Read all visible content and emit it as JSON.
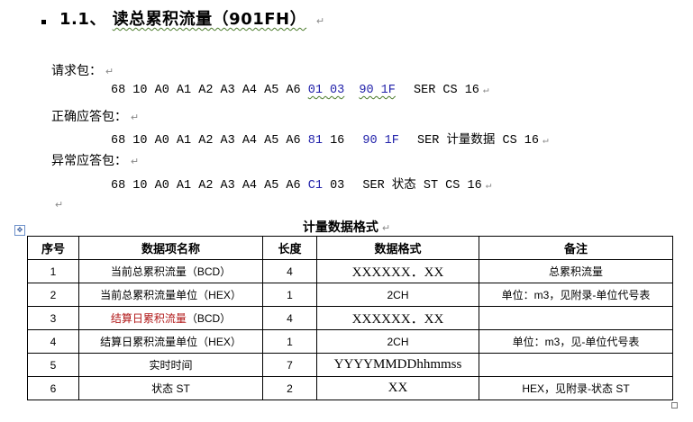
{
  "heading": {
    "number": "1.1、",
    "title": "读总累积流量（901FH）",
    "para_mark": "↵"
  },
  "request": {
    "label": "请求包：",
    "bytes": "68 10 A0 A1 A2 A3 A4 A5 A6",
    "blue_a": "01 03",
    "blue_b": "90 1F",
    "tail": "SER   CS   16"
  },
  "ack": {
    "label": "正确应答包：",
    "bytes": "68 10 A0 A1 A2 A3 A4 A5 A6",
    "blue_a": "81",
    "mid": "16",
    "blue_b": "90 1F",
    "tail": "SER 计量数据 CS   16"
  },
  "nak": {
    "label": "异常应答包：",
    "bytes": "68 10 A0 A1 A2 A3 A4 A5 A6",
    "blue_a": "C1",
    "mid": "03",
    "tail": "SER   状态 ST   CS   16"
  },
  "table_title": "计量数据格式",
  "table": {
    "headers": [
      "序号",
      "数据项名称",
      "长度",
      "数据格式",
      "备注"
    ],
    "rows": [
      {
        "no": "1",
        "name": "当前总累积流量（BCD）",
        "len": "4",
        "fmt": "XXXXXX．XX",
        "note": "总累积流量"
      },
      {
        "no": "2",
        "name": "当前总累积流量单位（HEX）",
        "len": "1",
        "fmt": "2CH",
        "note": "单位：m3，见附录-单位代号表"
      },
      {
        "no": "3",
        "name": "结算日累积流量（BCD）",
        "name_red": "结算日累积流量",
        "name_rest": "（BCD）",
        "len": "4",
        "fmt": "XXXXXX．XX",
        "note": ""
      },
      {
        "no": "4",
        "name": "结算日累积流量单位（HEX）",
        "len": "1",
        "fmt": "2CH",
        "note": "单位：m3，见-单位代号表"
      },
      {
        "no": "5",
        "name": "实时时间",
        "len": "7",
        "fmt": "YYYYMMDDhhmmss",
        "note": ""
      },
      {
        "no": "6",
        "name": "状态 ST",
        "len": "2",
        "fmt": "XX",
        "note": "HEX，见附录-状态 ST"
      }
    ]
  },
  "colors": {
    "blue": "#2222aa",
    "red": "#b11818",
    "wavy_underline": "#4a7a2a"
  },
  "icons": {
    "anchor": "move-anchor-icon",
    "para": "paragraph-mark"
  }
}
